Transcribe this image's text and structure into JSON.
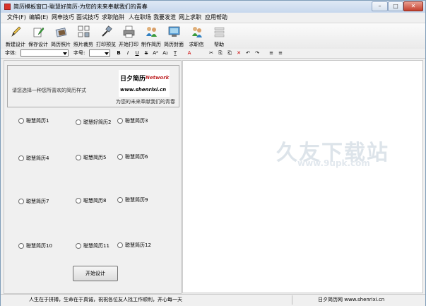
{
  "window": {
    "title": "简历模板窗口-聪慧好简历-为您的未来奉献我们的青春",
    "min_label": "–",
    "max_label": "□",
    "close_label": "✕"
  },
  "menu": [
    "文件(F)",
    "编辑(E)",
    "网申技巧",
    "面试技巧",
    "求职陷阱",
    "人在职场",
    "我要发泄",
    "网上求职",
    "应用帮助"
  ],
  "toolbar": [
    {
      "label": "新建设计",
      "icon": "pencil-icon"
    },
    {
      "label": "保存设计",
      "icon": "save-pencil-icon"
    },
    {
      "label": "简历照片",
      "icon": "photo-icon"
    },
    {
      "label": "照片裁剪",
      "icon": "crop-icon"
    },
    {
      "label": "打印预览",
      "icon": "print-preview-icon"
    },
    {
      "label": "开始打印",
      "icon": "printer-icon"
    },
    {
      "label": "制作简历",
      "icon": "people-icon"
    },
    {
      "label": "简历封面",
      "icon": "cover-icon"
    },
    {
      "label": "求职信",
      "icon": "letter-people-icon"
    },
    {
      "label": "帮助",
      "icon": "help-icon"
    }
  ],
  "format": {
    "font_label": "字体:",
    "size_label": "字号:",
    "font_value": "",
    "size_value": "",
    "buttons": [
      "B",
      "I",
      "U",
      "S",
      "A²",
      "A₂",
      "T̲",
      "A",
      "✂",
      "⎘",
      "⎗",
      "✕",
      "↶",
      "↷",
      "≡",
      "≡"
    ]
  },
  "banner": {
    "prompt": "请您选择一种您所喜欢的简历样式",
    "logo_top": "日夕简历",
    "logo_net": "Network",
    "logo_url": "www.shenrixi.cn",
    "slogan": "为您的未来奉献我们的青春"
  },
  "templates": [
    "聪慧简历1",
    "聪慧好简历2",
    "聪慧简历3",
    "聪慧简历4",
    "聪慧简历5",
    "聪慧简历6",
    "聪慧简历7",
    "聪慧简历8",
    "聪慧简历9",
    "聪慧简历10",
    "聪慧简历11",
    "聪慧简历12"
  ],
  "start_button": "开始设计",
  "watermark": {
    "text": "久友下载站",
    "url": "www.9upk.com"
  },
  "status": {
    "left": "人生在于拼搏，生命在于真诚，祝祝各位友人找工作顺利，开心每一天",
    "right": "日夕简历网 www.shenrixi.cn"
  }
}
